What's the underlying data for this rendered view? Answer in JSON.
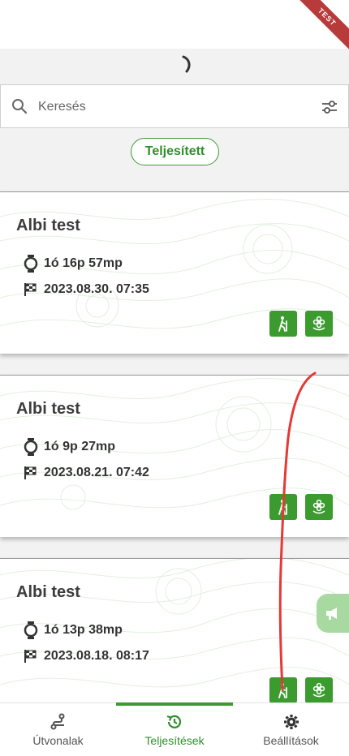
{
  "ribbon": {
    "label": "TEST"
  },
  "search": {
    "placeholder": "Keresés",
    "value": ""
  },
  "filter_chip": {
    "label": "Teljesített"
  },
  "cards": [
    {
      "title": "Albi test",
      "duration": "1ó 16p 57mp",
      "finished": "2023.08.30. 07:35"
    },
    {
      "title": "Albi test",
      "duration": "1ó 9p 27mp",
      "finished": "2023.08.21. 07:42"
    },
    {
      "title": "Albi test",
      "duration": "1ó 13p 38mp",
      "finished": "2023.08.18. 08:17"
    }
  ],
  "nav": {
    "items": [
      {
        "label": "Útvonalak",
        "icon": "route-icon"
      },
      {
        "label": "Teljesítések",
        "icon": "history-icon"
      },
      {
        "label": "Beállítások",
        "icon": "gear-icon"
      }
    ],
    "active_index": 1
  },
  "colors": {
    "accent": "#3b9b2f",
    "ribbon": "#b83b3b",
    "annotation": "#e53935"
  }
}
